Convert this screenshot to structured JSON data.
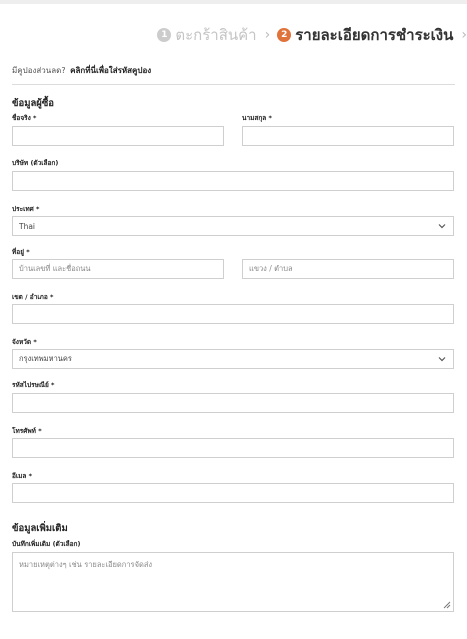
{
  "steps": [
    {
      "number": "1",
      "label": "ตะกร้าสินค้า"
    },
    {
      "number": "2",
      "label": "รายละเอียดการชำระเงิน"
    }
  ],
  "coupon": {
    "question": "มีคูปองส่วนลด?",
    "link": "คลิกที่นี่เพื่อใส่รหัสคูปอง"
  },
  "billing": {
    "title": "ข้อมูลผู้ซื้อ",
    "first_name": {
      "label": "ชื่อจริง *",
      "value": ""
    },
    "last_name": {
      "label": "นามสกุล *",
      "value": ""
    },
    "company": {
      "label": "บริษัท (ตัวเลือก)",
      "value": ""
    },
    "country": {
      "label": "ประเทศ *",
      "value": "Thai"
    },
    "address": {
      "label": "ที่อยู่ *",
      "placeholder_1": "บ้านเลขที่ และชื่อถนน",
      "placeholder_2": "แขวง / ตำบล"
    },
    "district": {
      "label": "เขต / อำเภอ *",
      "value": ""
    },
    "province": {
      "label": "จังหวัด *",
      "value": "กรุงเทพมหานคร"
    },
    "postcode": {
      "label": "รหัสไปรษณีย์ *",
      "value": ""
    },
    "phone": {
      "label": "โทรศัพท์ *",
      "value": ""
    },
    "email": {
      "label": "อีเมล *",
      "value": ""
    }
  },
  "additional": {
    "title": "ข้อมูลเพิ่มเติม",
    "notes": {
      "label": "บันทึกเพิ่มเติม (ตัวเลือก)",
      "placeholder": "หมายเหตุต่างๆ เช่น รายละเอียดการจัดส่ง"
    }
  },
  "colors": {
    "accent": "#e0733a",
    "inactive": "#cccccc",
    "border": "#cfcfcf"
  }
}
